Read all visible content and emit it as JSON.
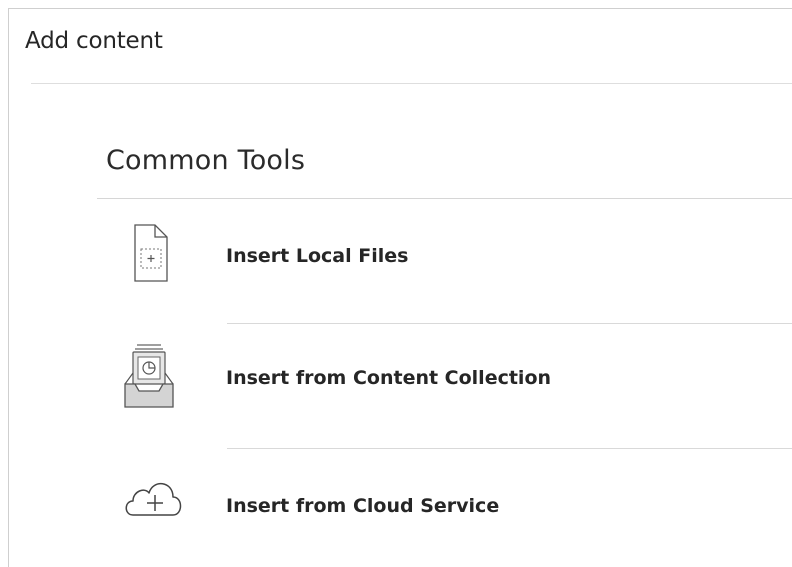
{
  "panel": {
    "title": "Add content"
  },
  "section": {
    "title": "Common Tools"
  },
  "tools": [
    {
      "label": "Insert Local Files",
      "icon": "file-add-icon"
    },
    {
      "label": "Insert from Content Collection",
      "icon": "content-collection-icon"
    },
    {
      "label": "Insert from Cloud Service",
      "icon": "cloud-add-icon"
    }
  ],
  "colors": {
    "text": "#262626",
    "icon_stroke": "#555555",
    "divider": "#d9d9d9"
  }
}
